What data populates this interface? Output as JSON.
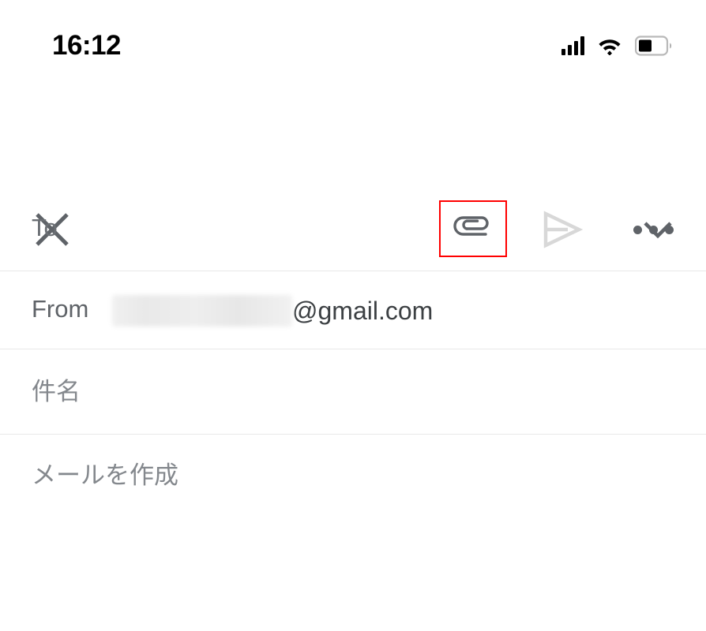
{
  "status_bar": {
    "time": "16:12",
    "signal_icon": "cellular-signal-icon",
    "signal_bars": 4,
    "wifi_icon": "wifi-icon",
    "battery_icon": "battery-icon",
    "battery_level_percent": 45
  },
  "toolbar": {
    "close_icon": "close-icon",
    "attach_icon": "attachment-paperclip-icon",
    "send_icon": "send-icon",
    "more_icon": "more-options-icon",
    "highlight_color": "#ff0000",
    "icon_color": "#5f6368",
    "send_icon_color": "#d8d8d8"
  },
  "fields": {
    "to": {
      "label": "To",
      "value": "",
      "expand_icon": "chevron-down-icon"
    },
    "from": {
      "label": "From",
      "account_redacted": true,
      "domain": "@gmail.com"
    },
    "subject": {
      "label": "件名",
      "value": ""
    }
  },
  "body": {
    "placeholder": "メールを作成",
    "value": ""
  }
}
